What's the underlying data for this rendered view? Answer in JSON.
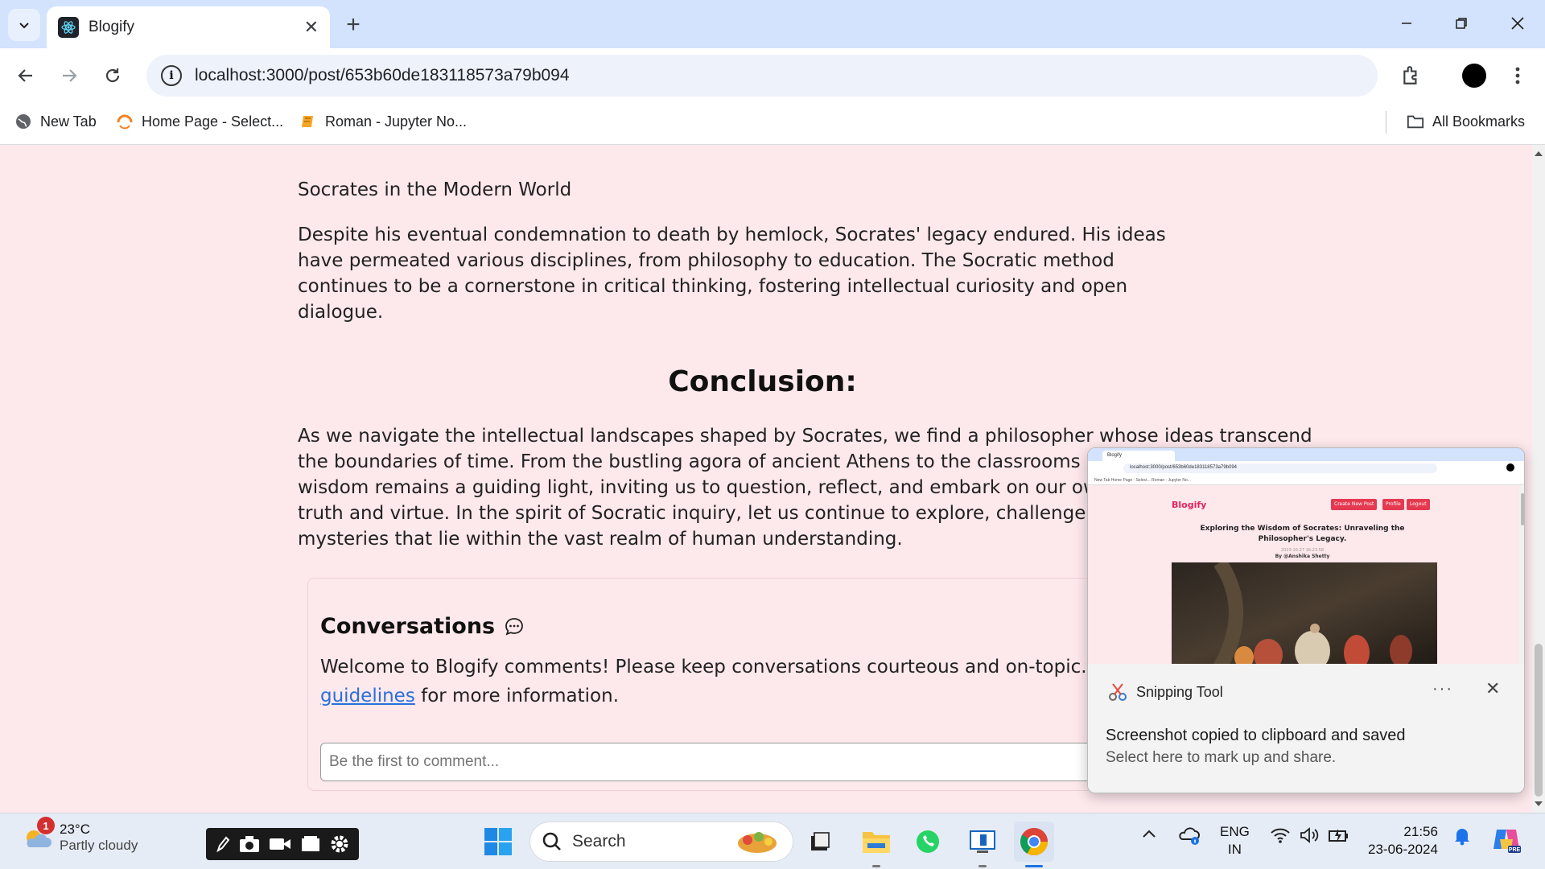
{
  "browser": {
    "tab_title": "Blogify",
    "url": "localhost:3000/post/653b60de183118573a79b094",
    "bookmarks": [
      "New Tab",
      "Home Page - Select...",
      "Roman - Jupyter No..."
    ],
    "all_bookmarks": "All Bookmarks"
  },
  "article": {
    "subheading": "Socrates in the Modern World",
    "paragraph1": "Despite his eventual condemnation to death by hemlock, Socrates' legacy endured. His ideas have permeated various disciplines, from philosophy to education. The Socratic method continues to be a cornerstone in critical thinking, fostering intellectual curiosity and open dialogue.",
    "conclusion_heading": "Conclusion:",
    "conclusion_lines": [
      "As we navigate the intellectual landscapes shaped by Socrates, we find a philosopher whose ideas transcend",
      "the boundaries of time. From the bustling agora of ancient Athens to the classrooms of today",
      "wisdom remains a guiding light, inviting us to question, reflect, and embark on our own journ",
      "truth and virtue. In the spirit of Socratic inquiry, let us continue to explore, challenge, and unr",
      "mysteries that lie within the vast realm of human understanding."
    ]
  },
  "comments": {
    "title": "Conversations",
    "welcome_before": "Welcome to Blogify comments! Please keep conversations courteous and on-topic. See ou",
    "link_text": "guidelines",
    "welcome_after": " for more information.",
    "input_placeholder": "Be the first to comment..."
  },
  "snip": {
    "app_name": "Snipping Tool",
    "message": "Screenshot copied to clipboard and saved",
    "sub": "Select here to mark up and share.",
    "thumb": {
      "tab": "Blogify",
      "url": "localhost:3000/post/653b60de183118573a79b094",
      "bookmarks": "New Tab   Home Page - Select...   Roman - Jupyter No...",
      "brand": "Blogify",
      "buttons": [
        "Create New Post",
        "Profile",
        "Logout"
      ],
      "title": "Exploring the Wisdom of Socrates: Unraveling the Philosopher's Legacy.",
      "date": "2023-10-27 16:23:58",
      "author": "By @Anshika Shetty"
    }
  },
  "taskbar": {
    "weather_temp": "23°C",
    "weather_cond": "Partly cloudy",
    "weather_badge": "1",
    "search_placeholder": "Search",
    "lang_top": "ENG",
    "lang_bottom": "IN",
    "time": "21:56",
    "date": "23-06-2024"
  },
  "colors": {
    "page_bg": "#fde8ec",
    "link": "#2a6fdb",
    "brand": "#e0245e"
  }
}
